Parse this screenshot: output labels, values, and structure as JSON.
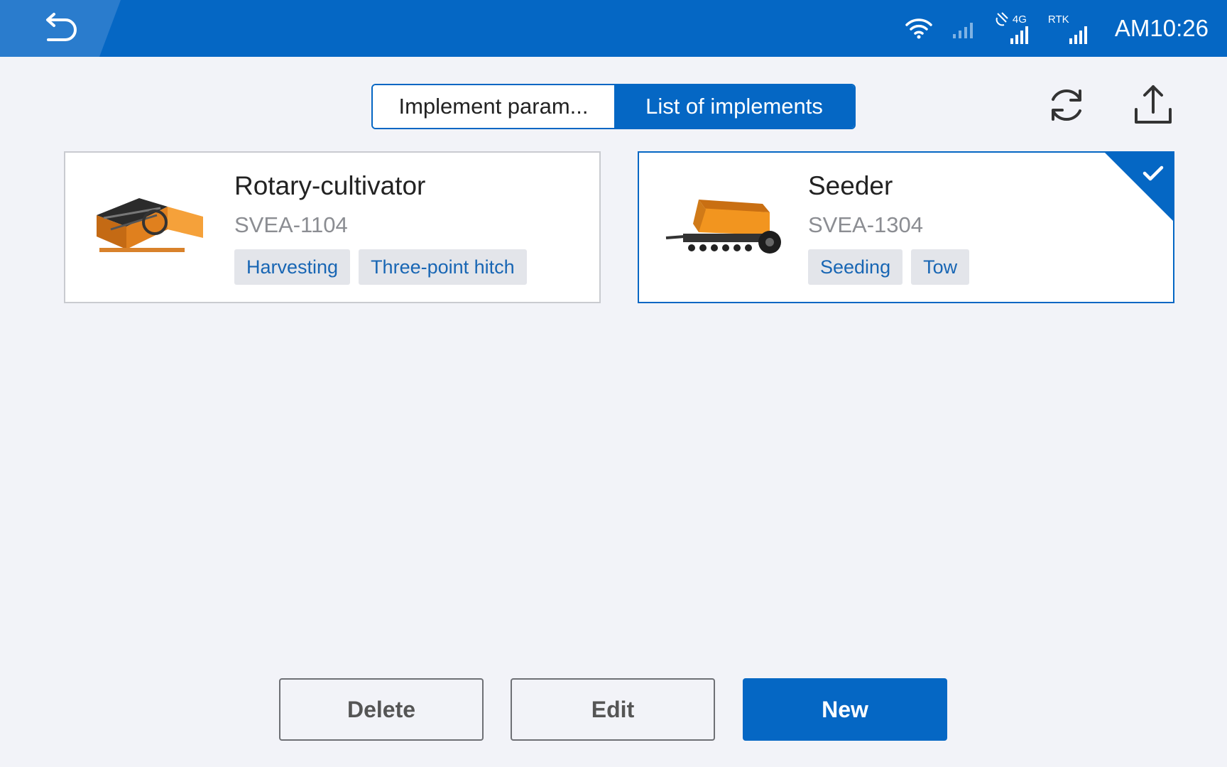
{
  "status_bar": {
    "network_label": "4G",
    "rtk_label": "RTK",
    "time": "AM10:26"
  },
  "tabs": [
    {
      "label": "Implement param...",
      "active": false
    },
    {
      "label": "List of implements",
      "active": true
    }
  ],
  "implements": [
    {
      "name": "Rotary-cultivator",
      "model": "SVEA-1104",
      "tags": [
        "Harvesting",
        "Three-point hitch"
      ],
      "selected": false
    },
    {
      "name": "Seeder",
      "model": "SVEA-1304",
      "tags": [
        "Seeding",
        "Tow"
      ],
      "selected": true
    }
  ],
  "actions": {
    "delete_label": "Delete",
    "edit_label": "Edit",
    "new_label": "New"
  },
  "colors": {
    "primary": "#0567c4",
    "background": "#f2f3f8",
    "tag_text": "#1866b4",
    "tag_bg": "#e3e5ea"
  },
  "icons": {
    "back": "back-arrow-icon",
    "wifi": "wifi-icon",
    "cell_signal": "cell-signal-icon",
    "satellite": "satellite-icon",
    "rtk_signal": "rtk-signal-icon",
    "refresh": "refresh-icon",
    "export": "upload-icon",
    "selected": "check-icon"
  }
}
